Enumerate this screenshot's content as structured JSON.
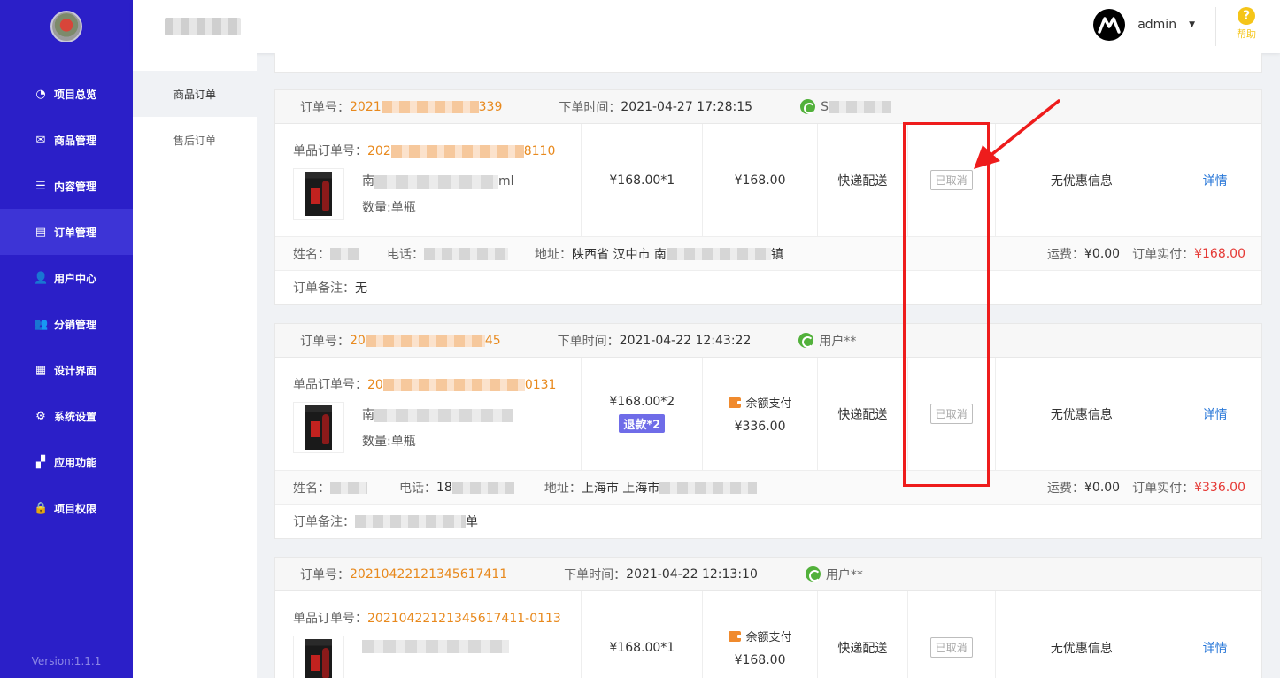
{
  "sidebar": {
    "menu": [
      {
        "label": "项目总览",
        "icon": "pie-chart-icon",
        "glyph": "◔"
      },
      {
        "label": "商品管理",
        "icon": "product-icon",
        "glyph": "✉"
      },
      {
        "label": "内容管理",
        "icon": "list-icon",
        "glyph": "☰"
      },
      {
        "label": "订单管理",
        "icon": "order-icon",
        "glyph": "▤"
      },
      {
        "label": "用户中心",
        "icon": "user-icon",
        "glyph": "👤"
      },
      {
        "label": "分销管理",
        "icon": "users-icon",
        "glyph": "👥"
      },
      {
        "label": "设计界面",
        "icon": "layout-icon",
        "glyph": "▦"
      },
      {
        "label": "系统设置",
        "icon": "gear-icon",
        "glyph": "⚙"
      },
      {
        "label": "应用功能",
        "icon": "apps-icon",
        "glyph": "▞"
      },
      {
        "label": "项目权限",
        "icon": "lock-icon",
        "glyph": "🔒"
      }
    ],
    "active_index": 3,
    "version": "Version:1.1.1"
  },
  "topbar": {
    "username": "admin",
    "help_label": "帮助",
    "help_glyph": "?"
  },
  "subnav": {
    "items": [
      "商品订单",
      "售后订单"
    ],
    "active_index": 0
  },
  "labels": {
    "order_no": "订单号：",
    "order_time": "下单时间：",
    "sub_order_no": "单品订单号：",
    "qty": "数量:单瓶",
    "name": "姓名：",
    "phone": "电话：",
    "address": "地址：",
    "freight": "运费：",
    "paid": "订单实付：",
    "remark": "订单备注：",
    "shipping": "快递配送",
    "status": "已取消",
    "discount": "无优惠信息",
    "detail": "详情",
    "balance_pay": "余额支付"
  },
  "orders": [
    {
      "order_no_start": "2021",
      "order_no_end": "339",
      "time": "2021-04-27 17:28:15",
      "user": "S",
      "sub_no_start": "202",
      "sub_no_end": "8110",
      "prod_name_start": "南",
      "prod_name_end": "ml",
      "price": "¥168.00*1",
      "total": "¥168.00",
      "address_start": "陕西省 汉中市 南",
      "address_end": "镇",
      "freight": "¥0.00",
      "paid": "¥168.00",
      "remark": "无"
    },
    {
      "order_no_start": "20",
      "order_no_end": "45",
      "time": "2021-04-22 12:43:22",
      "user": "用户**",
      "sub_no_start": "20",
      "sub_no_end": "0131",
      "prod_name_start": "南",
      "price": "¥168.00*2",
      "refund": "退款*2",
      "total": "¥336.00",
      "phone_start": "18",
      "address_start": "上海市 上海市",
      "freight": "¥0.00",
      "paid": "¥336.00",
      "remark_end": "单"
    },
    {
      "order_no": "20210422121345617411",
      "time": "2021-04-22 12:13:10",
      "user": "用户**",
      "sub_no": "20210422121345617411-0113",
      "price": "¥168.00*1",
      "total": "¥168.00"
    }
  ],
  "colors": {
    "sidebar": "#2b1fc8",
    "accent_orange": "#e8891d",
    "price_red": "#e53935",
    "link_blue": "#2a78d8",
    "annotation_red": "#ee1c1c"
  }
}
